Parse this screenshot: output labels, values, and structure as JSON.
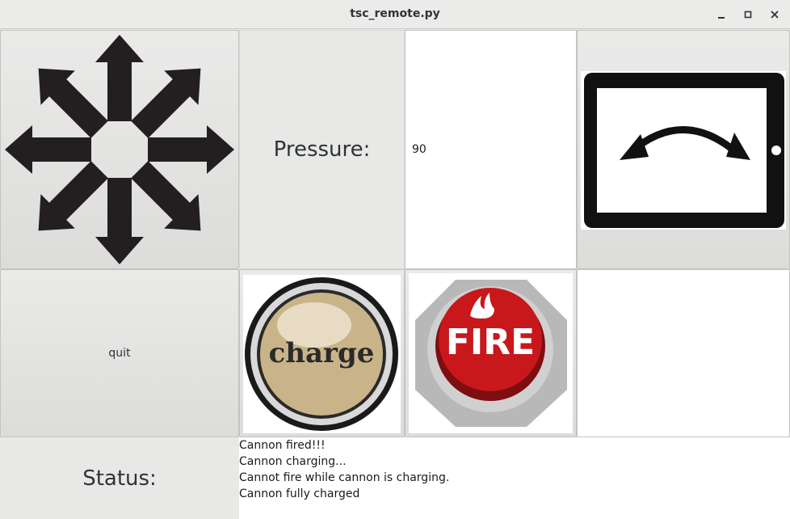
{
  "window": {
    "title": "tsc_remote.py",
    "minimize_icon": "minimize-icon",
    "maximize_icon": "maximize-icon",
    "close_icon": "close-icon"
  },
  "controls": {
    "move_icon": "eight-direction-arrows-icon",
    "pressure_label": "Pressure:",
    "pressure_value": "90",
    "tilt_icon": "tablet-rotate-icon",
    "quit_label": "quit",
    "charge_label": "charge",
    "fire_label": "FIRE"
  },
  "status": {
    "label": "Status:",
    "lines": [
      "Cannon fired!!!",
      "Cannon charging...",
      "Cannot fire while cannon is charging.",
      "Cannon fully charged"
    ]
  },
  "colors": {
    "fire_red": "#c8181c",
    "charge_gold": "#c9b489"
  }
}
